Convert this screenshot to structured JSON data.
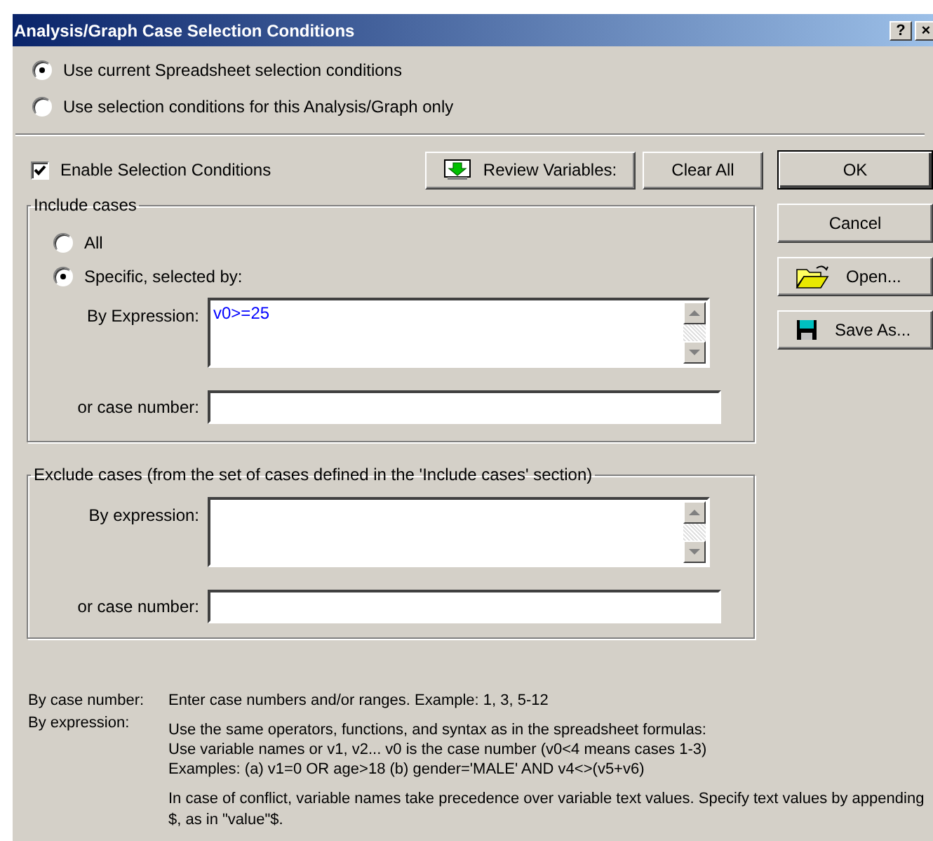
{
  "window": {
    "title": "Analysis/Graph Case Selection Conditions",
    "title_buttons": [
      "?",
      "×"
    ]
  },
  "source_options": [
    {
      "label": "Use current Spreadsheet selection conditions",
      "selected": true
    },
    {
      "label": "Use selection conditions for this Analysis/Graph only",
      "selected": false
    }
  ],
  "enable_checkbox": {
    "label": "Enable Selection Conditions",
    "checked": true
  },
  "toolbar_buttons": [
    {
      "label": "Review Variables:",
      "kind": "review"
    },
    {
      "label": "Clear All",
      "kind": "plain"
    }
  ],
  "side_buttons": [
    {
      "label": "OK",
      "kind": "default"
    },
    {
      "label": "Cancel",
      "kind": "plain"
    },
    {
      "label": "Open...",
      "kind": "open"
    },
    {
      "label": "Save As...",
      "kind": "save"
    }
  ],
  "include": {
    "title": "Include cases",
    "options": [
      {
        "label": "All",
        "selected": false
      },
      {
        "label": "Specific, selected by:",
        "selected": true
      }
    ],
    "expression_label": "By Expression:",
    "expression_value": "v0>=25",
    "case_label": "or case number:"
  },
  "exclude": {
    "title": "Exclude cases (from the set of cases defined in the 'Include cases' section)",
    "expression_label": "By expression:",
    "case_label": "or case number:"
  },
  "help": [
    {
      "term": "By case number:",
      "lines": [
        "Enter case numbers and/or ranges.   Example:  1, 3, 5-12"
      ]
    },
    {
      "term": "By expression:",
      "lines": [
        "Use the same operators, functions, and syntax as in the spreadsheet formulas:",
        "Use variable names or v1, v2...   v0 is the case number  (v0<4 means cases 1-3)",
        "Examples:   (a) v1=0  OR  age>18   (b) gender='MALE' AND v4<>(v5+v6)"
      ]
    }
  ],
  "note": "In case of conflict, variable names take precedence over variable text values. Specify text values by appending $, as in \"value\"$."
}
